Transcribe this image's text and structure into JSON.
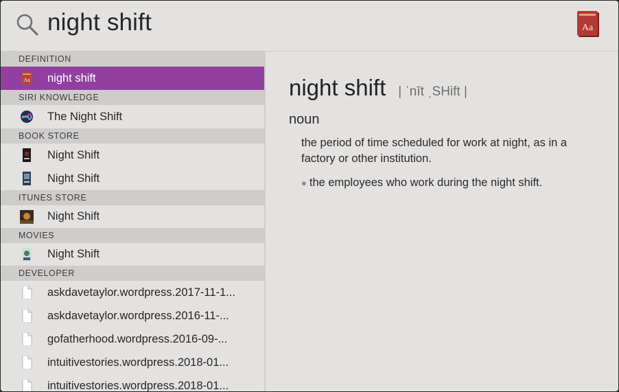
{
  "search": {
    "query": "night shift"
  },
  "sections": [
    {
      "header": "DEFINITION",
      "items": [
        {
          "label": "night shift",
          "icon": "dictionary-icon",
          "selected": true
        }
      ]
    },
    {
      "header": "SIRI KNOWLEDGE",
      "items": [
        {
          "label": "The Night Shift",
          "icon": "siri-icon"
        }
      ]
    },
    {
      "header": "BOOK STORE",
      "items": [
        {
          "label": "Night Shift",
          "icon": "book-cover-icon"
        },
        {
          "label": "Night Shift",
          "icon": "book-cover-icon"
        }
      ]
    },
    {
      "header": "ITUNES STORE",
      "items": [
        {
          "label": "Night Shift",
          "icon": "album-art-icon"
        }
      ]
    },
    {
      "header": "MOVIES",
      "items": [
        {
          "label": "Night Shift",
          "icon": "movie-poster-icon"
        }
      ]
    },
    {
      "header": "DEVELOPER",
      "items": [
        {
          "label": "askdavetaylor.wordpress.2017-11-1...",
          "icon": "document-icon"
        },
        {
          "label": "askdavetaylor.wordpress.2016-11-...",
          "icon": "document-icon"
        },
        {
          "label": "gofatherhood.wordpress.2016-09-...",
          "icon": "document-icon"
        },
        {
          "label": "intuitivestories.wordpress.2018-01...",
          "icon": "document-icon"
        },
        {
          "label": "intuitivestories.wordpress.2018-01...",
          "icon": "document-icon"
        }
      ]
    }
  ],
  "preview": {
    "headword": "night shift",
    "pronunciation": "| ˈnīt ˌSHift |",
    "part_of_speech": "noun",
    "definition": "the period of time scheduled for work at night, as in a factory or other institution.",
    "subdefinition": "the employees who work during the night shift."
  },
  "colors": {
    "selection": "#9140a0",
    "section_header_bg": "#cfcdcc",
    "panel_bg": "#e4e2e1"
  }
}
